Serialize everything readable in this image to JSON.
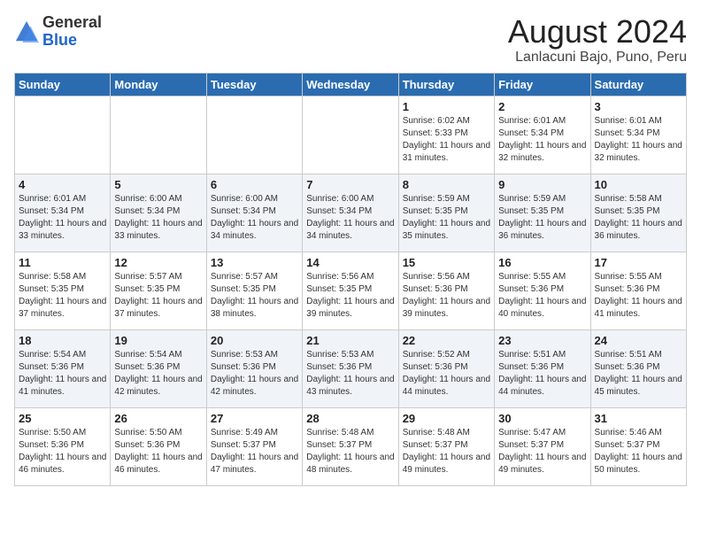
{
  "header": {
    "logo_general": "General",
    "logo_blue": "Blue",
    "title": "August 2024",
    "subtitle": "Lanlacuni Bajo, Puno, Peru"
  },
  "days_of_week": [
    "Sunday",
    "Monday",
    "Tuesday",
    "Wednesday",
    "Thursday",
    "Friday",
    "Saturday"
  ],
  "weeks": [
    [
      {
        "day": "",
        "info": ""
      },
      {
        "day": "",
        "info": ""
      },
      {
        "day": "",
        "info": ""
      },
      {
        "day": "",
        "info": ""
      },
      {
        "day": "1",
        "info": "Sunrise: 6:02 AM\nSunset: 5:33 PM\nDaylight: 11 hours and 31 minutes."
      },
      {
        "day": "2",
        "info": "Sunrise: 6:01 AM\nSunset: 5:34 PM\nDaylight: 11 hours and 32 minutes."
      },
      {
        "day": "3",
        "info": "Sunrise: 6:01 AM\nSunset: 5:34 PM\nDaylight: 11 hours and 32 minutes."
      }
    ],
    [
      {
        "day": "4",
        "info": "Sunrise: 6:01 AM\nSunset: 5:34 PM\nDaylight: 11 hours and 33 minutes."
      },
      {
        "day": "5",
        "info": "Sunrise: 6:00 AM\nSunset: 5:34 PM\nDaylight: 11 hours and 33 minutes."
      },
      {
        "day": "6",
        "info": "Sunrise: 6:00 AM\nSunset: 5:34 PM\nDaylight: 11 hours and 34 minutes."
      },
      {
        "day": "7",
        "info": "Sunrise: 6:00 AM\nSunset: 5:34 PM\nDaylight: 11 hours and 34 minutes."
      },
      {
        "day": "8",
        "info": "Sunrise: 5:59 AM\nSunset: 5:35 PM\nDaylight: 11 hours and 35 minutes."
      },
      {
        "day": "9",
        "info": "Sunrise: 5:59 AM\nSunset: 5:35 PM\nDaylight: 11 hours and 36 minutes."
      },
      {
        "day": "10",
        "info": "Sunrise: 5:58 AM\nSunset: 5:35 PM\nDaylight: 11 hours and 36 minutes."
      }
    ],
    [
      {
        "day": "11",
        "info": "Sunrise: 5:58 AM\nSunset: 5:35 PM\nDaylight: 11 hours and 37 minutes."
      },
      {
        "day": "12",
        "info": "Sunrise: 5:57 AM\nSunset: 5:35 PM\nDaylight: 11 hours and 37 minutes."
      },
      {
        "day": "13",
        "info": "Sunrise: 5:57 AM\nSunset: 5:35 PM\nDaylight: 11 hours and 38 minutes."
      },
      {
        "day": "14",
        "info": "Sunrise: 5:56 AM\nSunset: 5:35 PM\nDaylight: 11 hours and 39 minutes."
      },
      {
        "day": "15",
        "info": "Sunrise: 5:56 AM\nSunset: 5:36 PM\nDaylight: 11 hours and 39 minutes."
      },
      {
        "day": "16",
        "info": "Sunrise: 5:55 AM\nSunset: 5:36 PM\nDaylight: 11 hours and 40 minutes."
      },
      {
        "day": "17",
        "info": "Sunrise: 5:55 AM\nSunset: 5:36 PM\nDaylight: 11 hours and 41 minutes."
      }
    ],
    [
      {
        "day": "18",
        "info": "Sunrise: 5:54 AM\nSunset: 5:36 PM\nDaylight: 11 hours and 41 minutes."
      },
      {
        "day": "19",
        "info": "Sunrise: 5:54 AM\nSunset: 5:36 PM\nDaylight: 11 hours and 42 minutes."
      },
      {
        "day": "20",
        "info": "Sunrise: 5:53 AM\nSunset: 5:36 PM\nDaylight: 11 hours and 42 minutes."
      },
      {
        "day": "21",
        "info": "Sunrise: 5:53 AM\nSunset: 5:36 PM\nDaylight: 11 hours and 43 minutes."
      },
      {
        "day": "22",
        "info": "Sunrise: 5:52 AM\nSunset: 5:36 PM\nDaylight: 11 hours and 44 minutes."
      },
      {
        "day": "23",
        "info": "Sunrise: 5:51 AM\nSunset: 5:36 PM\nDaylight: 11 hours and 44 minutes."
      },
      {
        "day": "24",
        "info": "Sunrise: 5:51 AM\nSunset: 5:36 PM\nDaylight: 11 hours and 45 minutes."
      }
    ],
    [
      {
        "day": "25",
        "info": "Sunrise: 5:50 AM\nSunset: 5:36 PM\nDaylight: 11 hours and 46 minutes."
      },
      {
        "day": "26",
        "info": "Sunrise: 5:50 AM\nSunset: 5:36 PM\nDaylight: 11 hours and 46 minutes."
      },
      {
        "day": "27",
        "info": "Sunrise: 5:49 AM\nSunset: 5:37 PM\nDaylight: 11 hours and 47 minutes."
      },
      {
        "day": "28",
        "info": "Sunrise: 5:48 AM\nSunset: 5:37 PM\nDaylight: 11 hours and 48 minutes."
      },
      {
        "day": "29",
        "info": "Sunrise: 5:48 AM\nSunset: 5:37 PM\nDaylight: 11 hours and 49 minutes."
      },
      {
        "day": "30",
        "info": "Sunrise: 5:47 AM\nSunset: 5:37 PM\nDaylight: 11 hours and 49 minutes."
      },
      {
        "day": "31",
        "info": "Sunrise: 5:46 AM\nSunset: 5:37 PM\nDaylight: 11 hours and 50 minutes."
      }
    ]
  ]
}
